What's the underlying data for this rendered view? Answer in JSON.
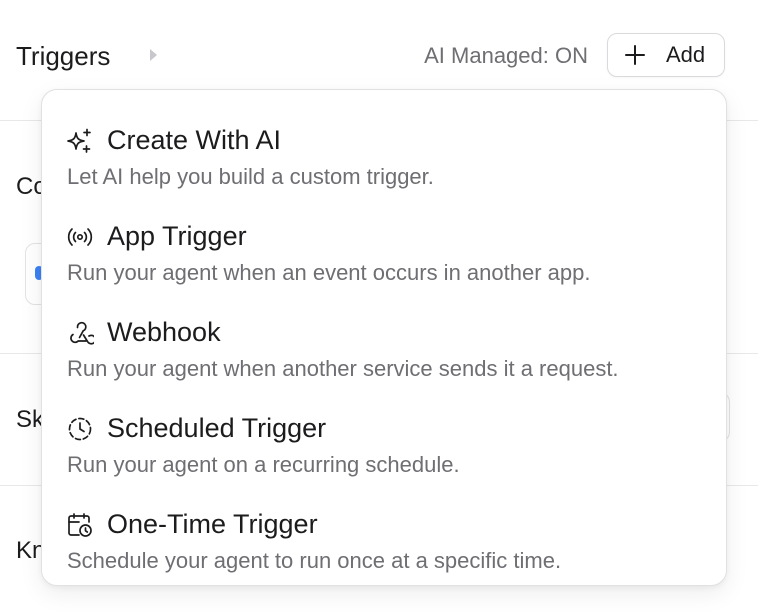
{
  "header": {
    "title": "Triggers",
    "ai_managed": "AI Managed: ON",
    "add_label": "Add"
  },
  "background": {
    "section_labels": [
      "Co",
      "Sk",
      "Kn"
    ]
  },
  "menu": {
    "items": [
      {
        "icon": "sparkles-icon",
        "title": "Create With AI",
        "description": "Let AI help you build a custom trigger."
      },
      {
        "icon": "broadcast-icon",
        "title": "App Trigger",
        "description": "Run your agent when an event occurs in another app."
      },
      {
        "icon": "webhook-icon",
        "title": "Webhook",
        "description": "Run your agent when another service sends it a request."
      },
      {
        "icon": "clock-dashed-icon",
        "title": "Scheduled Trigger",
        "description": "Run your agent on a recurring schedule."
      },
      {
        "icon": "calendar-clock-icon",
        "title": "One-Time Trigger",
        "description": "Schedule your agent to run once at a specific time."
      }
    ]
  },
  "colors": {
    "text_primary": "#1c1c1e",
    "text_secondary": "#6e6e73",
    "border": "#e1e1e4",
    "accent_blue": "#3b82f6"
  }
}
